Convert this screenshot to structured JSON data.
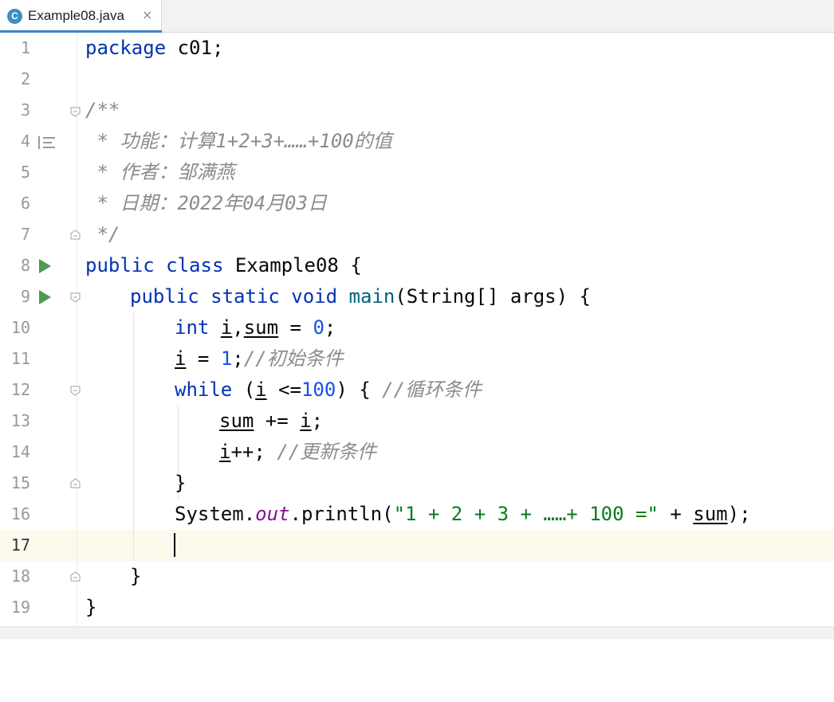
{
  "tab": {
    "title": "Example08.java",
    "icon_letter": "C",
    "close": "×"
  },
  "line_numbers": [
    "1",
    "2",
    "3",
    "4",
    "5",
    "6",
    "7",
    "8",
    "9",
    "10",
    "11",
    "12",
    "13",
    "14",
    "15",
    "16",
    "17",
    "18",
    "19"
  ],
  "code": {
    "l1": {
      "kw": "package",
      "rest": " c01;"
    },
    "l3": "/**",
    "l4": " * 功能：计算1+2+3+……+100的值",
    "l5": " * 作者：邹满燕",
    "l6": " * 日期：2022年04月03日",
    "l7": " */",
    "l8": {
      "kw": "public class",
      "rest": " Example08 {"
    },
    "l9": {
      "kw": "public static void",
      "fn": "main",
      "rest": "(String[] args) {"
    },
    "l10": {
      "kw": "int",
      "i": "i",
      "comma": ",",
      "sum": "sum",
      "eq": " = ",
      "num": "0",
      "end": ";"
    },
    "l11": {
      "i": "i",
      "eq": " = ",
      "num": "1",
      "end": ";",
      "cmt": "//初始条件"
    },
    "l12": {
      "kw": "while",
      "open": " (",
      "i": "i",
      "op": " <=",
      "num": "100",
      "close": ") { ",
      "cmt": "//循环条件"
    },
    "l13": {
      "sum": "sum",
      "op": " += ",
      "i": "i",
      "end": ";"
    },
    "l14": {
      "i": "i",
      "op": "++; ",
      "cmt": "//更新条件"
    },
    "l15": "}",
    "l16": {
      "cls": "System.",
      "field": "out",
      "call": ".println(",
      "str": "\"1 + 2 + 3 + ……+ 100 =\"",
      "plus": " + ",
      "sum": "sum",
      "end": ");"
    },
    "l18": "}",
    "l19": "}"
  },
  "colors": {
    "keyword": "#0033b3",
    "number": "#1750eb",
    "string": "#067d17",
    "comment": "#8c8c8c",
    "field": "#871094",
    "run": "#499c54",
    "current_line": "#fcfaed"
  }
}
